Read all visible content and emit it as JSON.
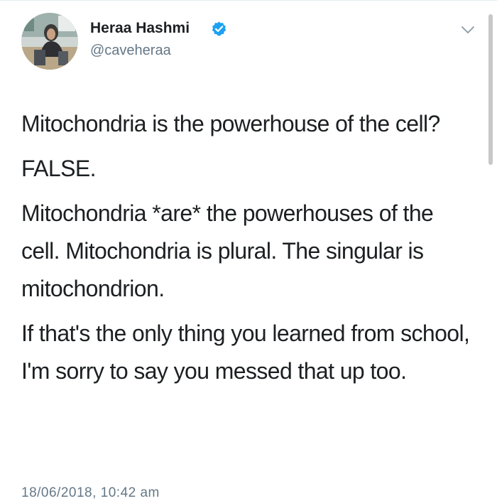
{
  "user": {
    "display_name": "Heraa Hashmi",
    "handle": "@caveheraa",
    "verified": true,
    "verified_color": "#1da1f2"
  },
  "icons": {
    "verified": "verified-badge-icon",
    "menu": "chevron-down-icon"
  },
  "tweet": {
    "paragraphs": [
      "Mitochondria is the powerhouse of the cell?",
      "FALSE.",
      "Mitochondria *are* the powerhouses of the cell. Mitochondria is plural. The singular is mitochondrion.",
      "If that's the only thing you learned from school, I'm sorry to say you messed that up too."
    ],
    "timestamp": "18/06/2018, 10:42 am"
  },
  "colors": {
    "text": "#1c2022",
    "secondary": "#657786"
  }
}
